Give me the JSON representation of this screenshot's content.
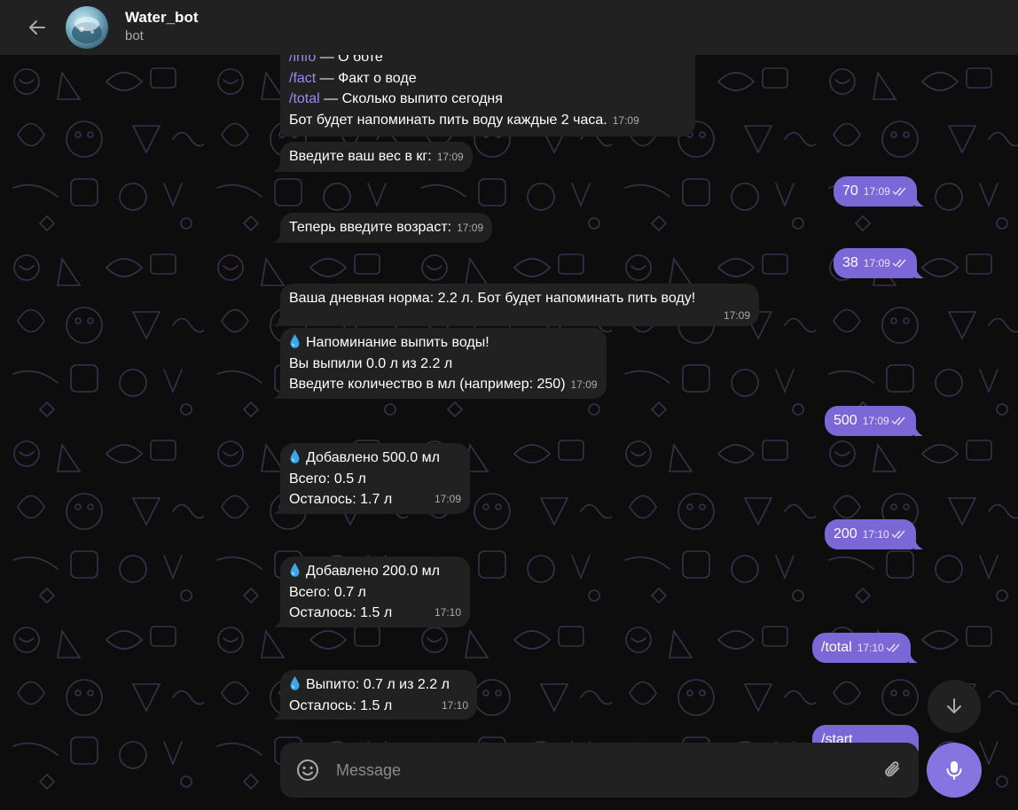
{
  "header": {
    "title": "Water_bot",
    "subtitle": "bot"
  },
  "messages": {
    "m1": {
      "lines": [
        {
          "cmd": "/info",
          "text": " — О боте"
        },
        {
          "cmd": "/fact",
          "text": " — Факт о воде"
        },
        {
          "cmd": "/total",
          "text": " — Сколько выпито сегодня"
        }
      ],
      "last_line": "Бот будет напоминать пить воду каждые 2 часа.",
      "time": "17:09"
    },
    "m2": {
      "text": "Введите ваш вес в кг:",
      "time": "17:09"
    },
    "m3": {
      "text": "70",
      "time": "17:09"
    },
    "m4": {
      "text": "Теперь введите возраст:",
      "time": "17:09"
    },
    "m5": {
      "text": "38",
      "time": "17:09"
    },
    "m6": {
      "text": "Ваша дневная норма: 2.2 л. Бот будет напоминать пить воду!",
      "time": "17:09"
    },
    "m7": {
      "l1": "Напоминание выпить воды!",
      "l2": "Вы выпили 0.0 л из 2.2 л",
      "l3": "Введите количество в мл (например: 250)",
      "time": "17:09"
    },
    "m8": {
      "text": "500",
      "time": "17:09"
    },
    "m9": {
      "l1": "Добавлено 500.0 мл",
      "l2": "Всего: 0.5 л",
      "l3": "Осталось: 1.7 л",
      "time": "17:09"
    },
    "m10": {
      "text": "200",
      "time": "17:10"
    },
    "m11": {
      "l1": "Добавлено 200.0 мл",
      "l2": "Всего: 0.7 л",
      "l3": "Осталось: 1.5 л",
      "time": "17:10"
    },
    "m12": {
      "text": "/total",
      "time": "17:10"
    },
    "m13": {
      "l1": "Выпито: 0.7 л из 2.2 л",
      "l2": "Осталось: 1.5 л",
      "time": "17:10"
    },
    "m14": {
      "text": "/start"
    }
  },
  "composer": {
    "placeholder": "Message"
  },
  "icons": {
    "back": "arrow-left-icon",
    "emoji": "smile-icon",
    "attach": "paperclip-icon",
    "mic": "microphone-icon",
    "scroll_down": "arrow-down-icon",
    "drop": "droplet-icon"
  },
  "colors": {
    "header_bg": "#212121",
    "chat_bg": "#0d0d0d",
    "incoming_bubble": "#212121",
    "outgoing_bubble": "#7b67d6",
    "accent": "#8774e1",
    "command_link": "#9b8af0"
  }
}
